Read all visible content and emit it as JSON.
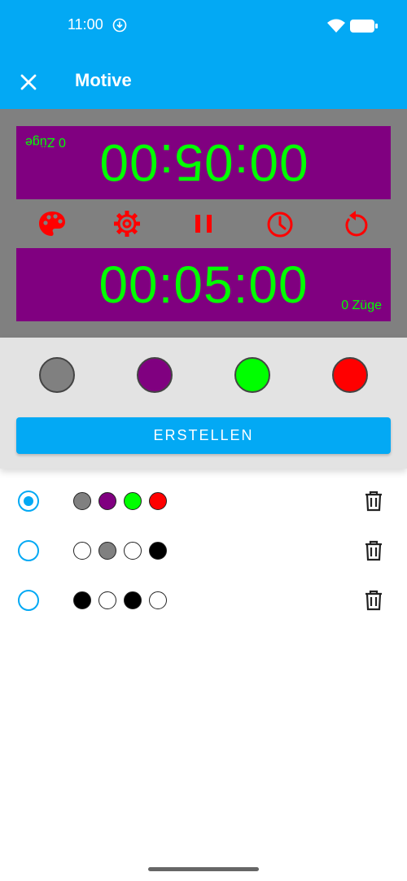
{
  "status_bar": {
    "time": "11:00"
  },
  "app_bar": {
    "title": "Motive"
  },
  "preview": {
    "top_clock": {
      "time": "00:05:00",
      "moves": "0 Züge",
      "bg": "#800080",
      "text_color": "#00ff00"
    },
    "bottom_clock": {
      "time": "00:05:00",
      "moves": "0 Züge",
      "bg": "#800080",
      "text_color": "#00ff00"
    },
    "background": "#808080",
    "controls": [
      "palette-icon",
      "settings-icon",
      "pause-icon",
      "clock-icon",
      "reset-icon"
    ],
    "control_color": "#ff0000"
  },
  "editor": {
    "swatches": [
      "#808080",
      "#800080",
      "#00ff00",
      "#ff0000"
    ],
    "create_label": "ERSTELLEN"
  },
  "themes": [
    {
      "selected": true,
      "colors": [
        "#808080",
        "#800080",
        "#00ff00",
        "#ff0000"
      ]
    },
    {
      "selected": false,
      "colors": [
        "#ffffff",
        "#808080",
        "#ffffff",
        "#000000"
      ]
    },
    {
      "selected": false,
      "colors": [
        "#000000",
        "#ffffff",
        "#000000",
        "#ffffff"
      ]
    }
  ],
  "colors": {
    "accent": "#03a9f4"
  }
}
